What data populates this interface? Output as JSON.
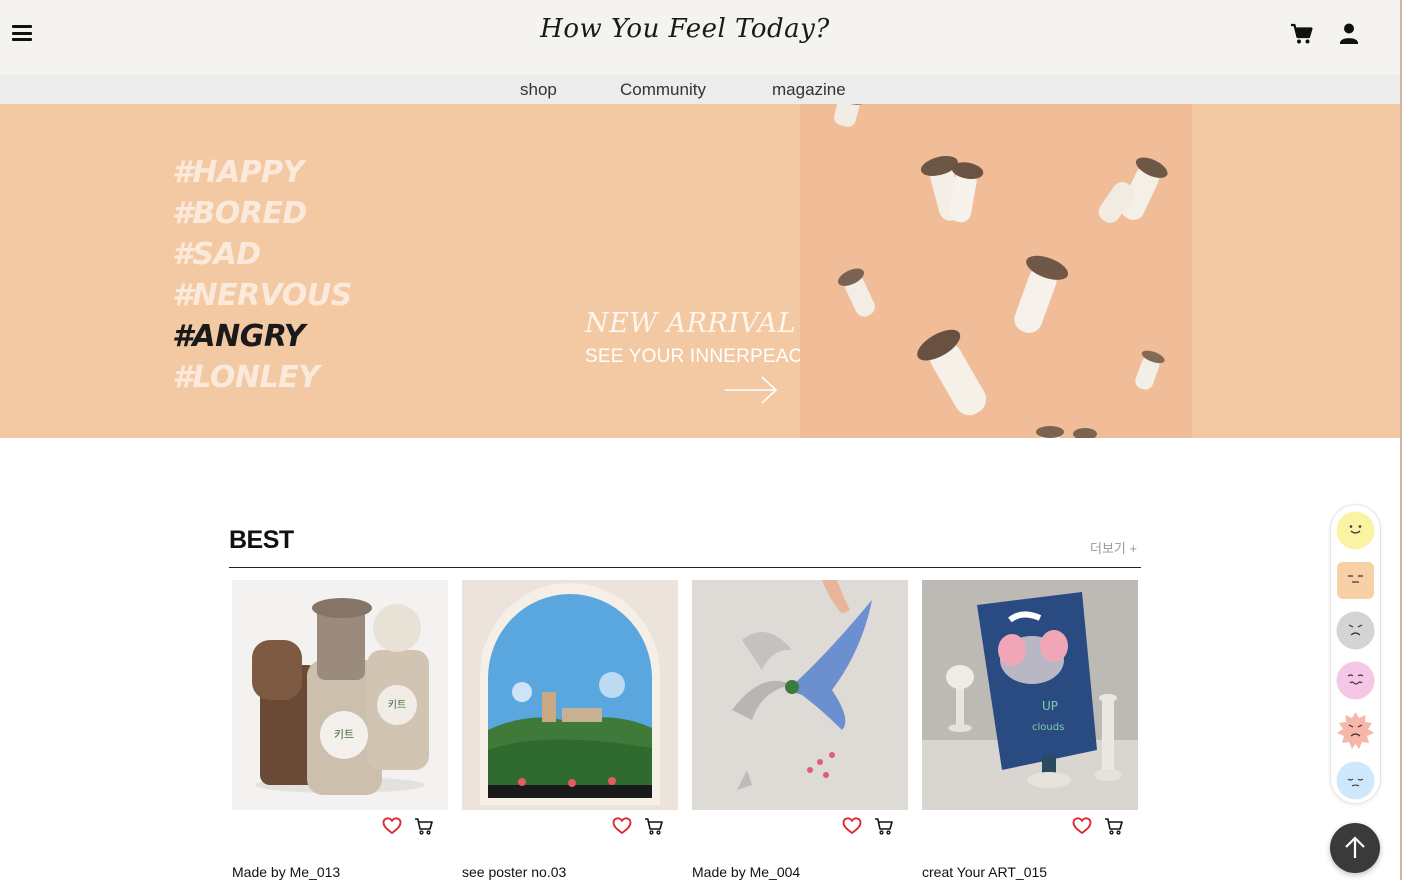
{
  "header": {
    "logo": "How You Feel Today?",
    "icons": [
      "menu-icon",
      "cart-icon",
      "user-icon"
    ]
  },
  "nav": {
    "items": [
      {
        "label": "shop"
      },
      {
        "label": "Community"
      },
      {
        "label": "magazine"
      }
    ]
  },
  "hero": {
    "tags": [
      "#HAPPY",
      "#BORED",
      "#SAD",
      "#NERVOUS",
      "#ANGRY",
      "#LONLEY"
    ],
    "active_tag": "#ANGRY",
    "headline": "NEW ARRIVAL",
    "subline": "SEE YOUR INNERPEACE",
    "background_color": "#f3c9a3"
  },
  "best": {
    "title": "BEST",
    "more_label": "더보기 +",
    "products": [
      {
        "name": "Made by Me_013"
      },
      {
        "name": "see poster no.03"
      },
      {
        "name": "Made by Me_004"
      },
      {
        "name": "creat Your ART_015"
      }
    ]
  },
  "moods": [
    {
      "icon": "happy-face-icon",
      "color": "#fbf3a4"
    },
    {
      "icon": "bored-face-icon",
      "color": "#f8d0a8"
    },
    {
      "icon": "sad-face-icon",
      "color": "#d4d4d4"
    },
    {
      "icon": "nervous-face-icon",
      "color": "#f6c6e6"
    },
    {
      "icon": "angry-face-icon",
      "color": "#f6b7a8"
    },
    {
      "icon": "lonely-face-icon",
      "color": "#cfe7fa"
    }
  ],
  "colors": {
    "header_bg": "#f5f3ef",
    "nav_bg": "#ececec",
    "heart": "#e0262d"
  }
}
